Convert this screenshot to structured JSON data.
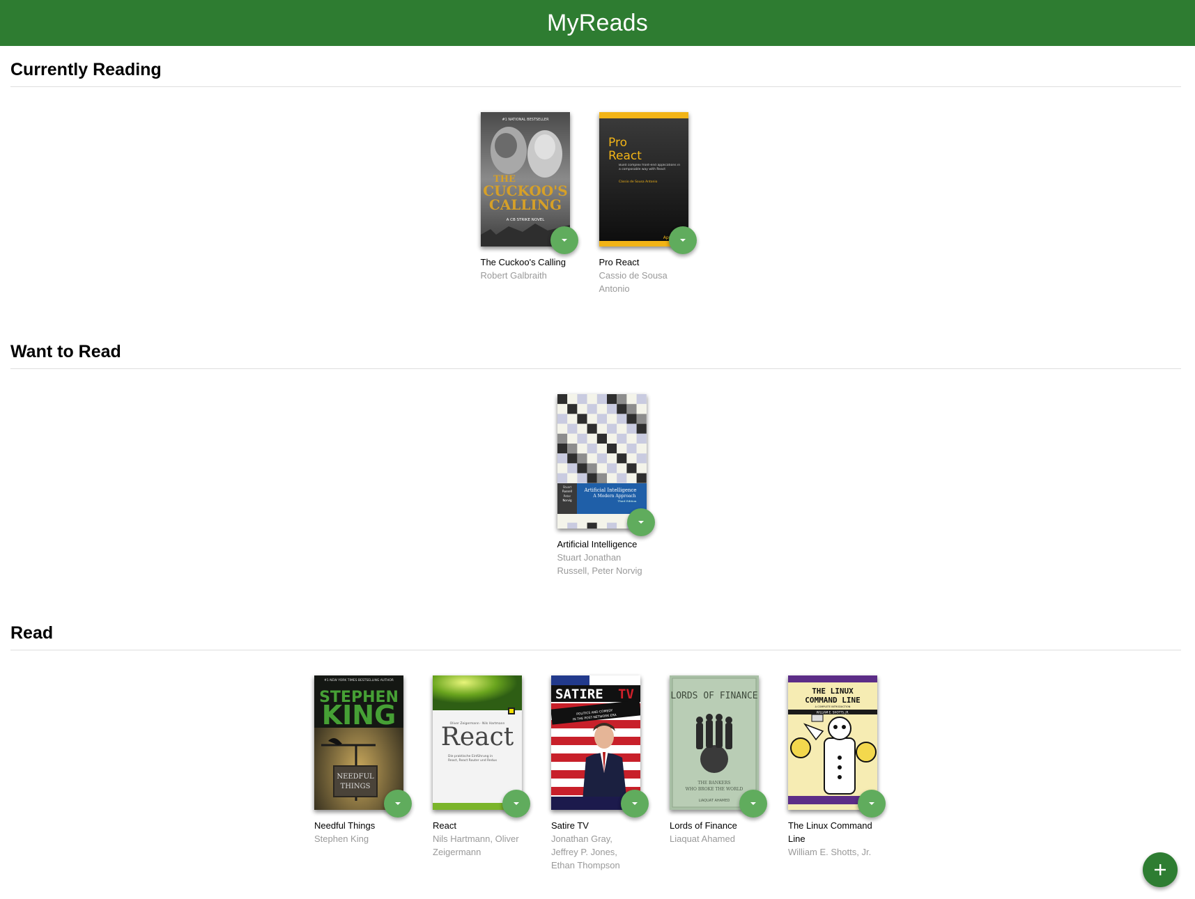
{
  "header": {
    "title": "MyReads"
  },
  "colors": {
    "header_bg": "#2e7c31",
    "changer_bg": "#60ac5d",
    "add_button_bg": "#2e7d32",
    "author_text": "#999999"
  },
  "icons": {
    "shelf_changer": "triangle-down-icon",
    "add_book": "plus-icon"
  },
  "shelves": [
    {
      "title": "Currently Reading",
      "books": [
        {
          "title": "The Cuckoo's Calling",
          "authors": "Robert Galbraith",
          "cover": "cuckoo"
        },
        {
          "title": "Pro React",
          "authors": "Cassio de Sousa Antonio",
          "cover": "proreact"
        }
      ]
    },
    {
      "title": "Want to Read",
      "books": [
        {
          "title": "Artificial Intelligence",
          "authors": "Stuart Jonathan Russell, Peter Norvig",
          "cover": "ai"
        }
      ]
    },
    {
      "title": "Read",
      "books": [
        {
          "title": "Needful Things",
          "authors": "Stephen King",
          "cover": "needful"
        },
        {
          "title": "React",
          "authors": "Nils Hartmann, Oliver Zeigermann",
          "cover": "react"
        },
        {
          "title": "Satire TV",
          "authors": "Jonathan Gray, Jeffrey P. Jones, Ethan Thompson",
          "cover": "satire"
        },
        {
          "title": "Lords of Finance",
          "authors": "Liaquat Ahamed",
          "cover": "lords"
        },
        {
          "title": "The Linux Command Line",
          "authors": "William E. Shotts, Jr.",
          "cover": "linux"
        }
      ]
    }
  ],
  "covers": {
    "cuckoo": {
      "top": "#1 NATIONAL BESTSELLER",
      "line1": "THE",
      "line2": "CUCKOO'S",
      "line3": "CALLING",
      "sub": "A CB STRIKE NOVEL"
    },
    "proreact": {
      "line1": "Pro",
      "line2": "React",
      "sub": "Build complex front-end applications in a composable way with React",
      "author": "Cássio de Sousa Antonio",
      "brand": "Apress"
    },
    "ai": {
      "line1": "Artificial Intelligence",
      "line2": "A Modern Approach",
      "edition": "Third Edition",
      "a1": "Stuart",
      "a2": "Russell",
      "a3": "Peter",
      "a4": "Norvig"
    },
    "needful": {
      "top": "#1 NEW YORK TIMES BESTSELLING AUTHOR",
      "line1": "STEPHEN",
      "line2": "KING",
      "sign1": "NEEDFUL",
      "sign2": "THINGS"
    },
    "react": {
      "authors": "Oliver Zeigermann · Nils Hartmann",
      "title": "React",
      "sub1": "Die praktische Einführung in",
      "sub2": "React, React Router und Redux"
    },
    "satire": {
      "line1": "SATIRE",
      "line2": "TV",
      "sub1": "POLITICS AND COMEDY",
      "sub2": "IN THE POST-NETWORK ERA"
    },
    "lords": {
      "line1": "LORDS OF FINANCE",
      "sub1": "THE BANKERS",
      "sub2": "WHO BROKE THE WORLD",
      "author": "LIAQUAT AHAMED"
    },
    "linux": {
      "line1": "THE LINUX",
      "line2": "COMMAND LINE",
      "sub": "A COMPLETE INTRODUCTION",
      "author": "WILLIAM E. SHOTTS, JR."
    }
  }
}
